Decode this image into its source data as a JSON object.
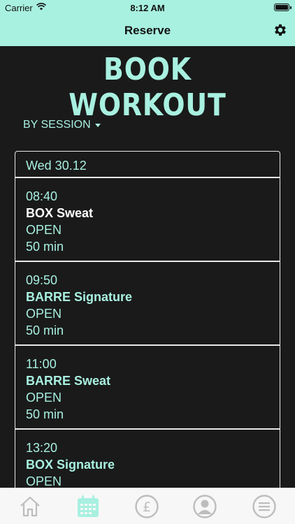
{
  "status_bar": {
    "carrier": "Carrier",
    "time": "8:12 AM"
  },
  "nav": {
    "title": "Reserve",
    "settings_icon": "gear-icon"
  },
  "page": {
    "heading": "BOOK WORKOUT",
    "filter_label": "BY SESSION"
  },
  "schedule": {
    "day": "Wed 30.12",
    "sessions": [
      {
        "time": "08:40",
        "name": "BOX Sweat",
        "status": "OPEN",
        "duration": "50 min",
        "name_color": "#ffffff"
      },
      {
        "time": "09:50",
        "name": "BARRE Signature",
        "status": "OPEN",
        "duration": "50 min",
        "name_color": "#a8f0e0"
      },
      {
        "time": "11:00",
        "name": "BARRE Sweat",
        "status": "OPEN",
        "duration": "50 min",
        "name_color": "#a8f0e0"
      },
      {
        "time": "13:20",
        "name": "BOX Signature",
        "status": "OPEN",
        "duration": "",
        "name_color": "#a8f0e0"
      }
    ]
  },
  "tab_bar": {
    "tabs": [
      {
        "icon": "home-icon",
        "active": false
      },
      {
        "icon": "calendar-icon",
        "active": true
      },
      {
        "icon": "pound-icon",
        "active": false
      },
      {
        "icon": "profile-icon",
        "active": false
      },
      {
        "icon": "menu-icon",
        "active": false
      }
    ]
  },
  "colors": {
    "accent": "#a8f0e0",
    "background": "#1a1a1a",
    "inactive_icon": "#bdbdbd"
  }
}
